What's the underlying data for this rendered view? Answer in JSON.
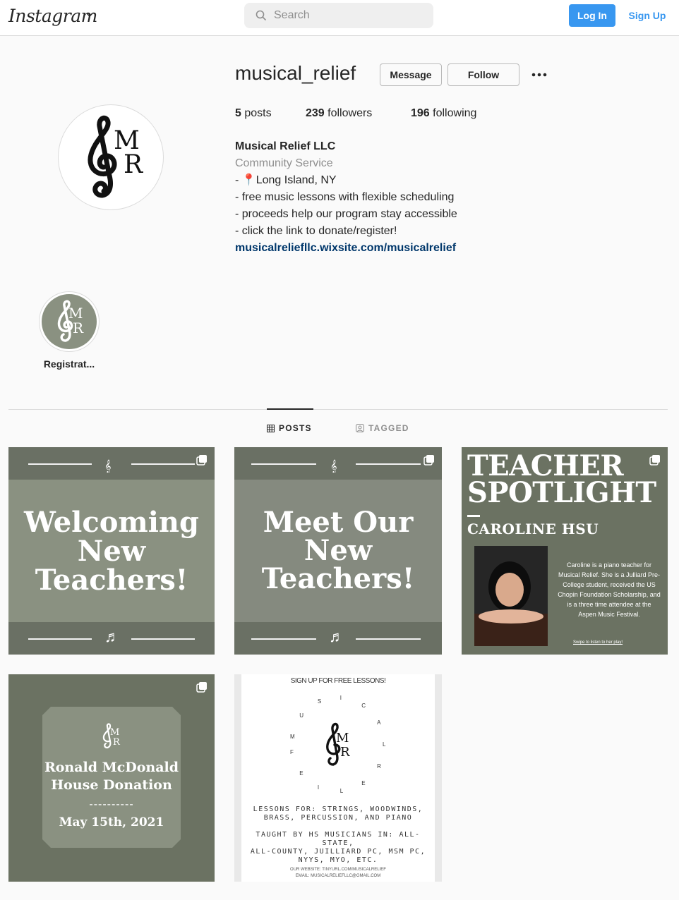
{
  "nav": {
    "logo": "Instagram",
    "search_placeholder": "Search",
    "login_label": "Log In",
    "signup_label": "Sign Up"
  },
  "profile": {
    "username": "musical_relief",
    "message_label": "Message",
    "follow_label": "Follow",
    "stats": {
      "posts_count": "5",
      "posts_label": "posts",
      "followers_count": "239",
      "followers_label": "followers",
      "following_count": "196",
      "following_label": "following"
    },
    "bio": {
      "name": "Musical Relief LLC",
      "category": "Community Service",
      "line1_prefix": "- ",
      "line1_pin": "📍",
      "line1_text": "Long Island, NY",
      "line2": "- free music lessons with flexible scheduling",
      "line3": "- proceeds help our program stay accessible",
      "line4": "- click the link to donate/register!",
      "link": "musicalreliefllc.wixsite.com/musicalrelief"
    },
    "avatar_logo": {
      "letter1": "M",
      "letter2": "R"
    }
  },
  "highlights": [
    {
      "label": "Registrat..."
    }
  ],
  "tabs": [
    {
      "label": "POSTS",
      "active": true
    },
    {
      "label": "TAGGED",
      "active": false
    }
  ],
  "posts": [
    {
      "title_lines": [
        "Welcoming",
        "New",
        "Teachers!"
      ]
    },
    {
      "title_lines": [
        "Meet Our",
        "New",
        "Teachers!"
      ]
    },
    {
      "title_lines": [
        "TEACHER",
        "SPOTLIGHT"
      ],
      "name": "CAROLINE HSU",
      "desc": "Caroline is a piano teacher for Musical Relief. She is a Julliard Pre-College student, received the US Chopin Foundation Scholarship, and is a three time attendee at the Aspen Music Festival.",
      "swipe": "Swipe to listen to her play!"
    },
    {
      "title_lines": [
        "Ronald McDonald",
        "House Donation"
      ],
      "dashes": "----------",
      "date": "May 15th, 2021"
    },
    {
      "header": "SIGN UP FOR FREE LESSONS!",
      "ring_letters": [
        "M",
        "U",
        "S",
        "I",
        "C",
        "A",
        "L",
        "R",
        "E",
        "L",
        "I",
        "E",
        "F"
      ],
      "lessons": [
        "LESSONS FOR: STRINGS, WOODWINDS,",
        "BRASS, PERCUSSION, AND PIANO"
      ],
      "taught": [
        "TAUGHT BY HS MUSICIANS IN: ALL-STATE,",
        "ALL-COUNTY, JUILLIARD PC, MSM PC,",
        "NYYS, MYO, ETC."
      ],
      "website": "OUR WEBSITE: TINYURL.COM/MUSICALRELIEF",
      "email": "EMAIL: MUSICALRELIEFLLC@GMAIL.COM"
    }
  ],
  "colors": {
    "accent": "#3897f0",
    "link": "#00376b",
    "post_green": "#8a9181",
    "post_dark": "#6b7262"
  }
}
